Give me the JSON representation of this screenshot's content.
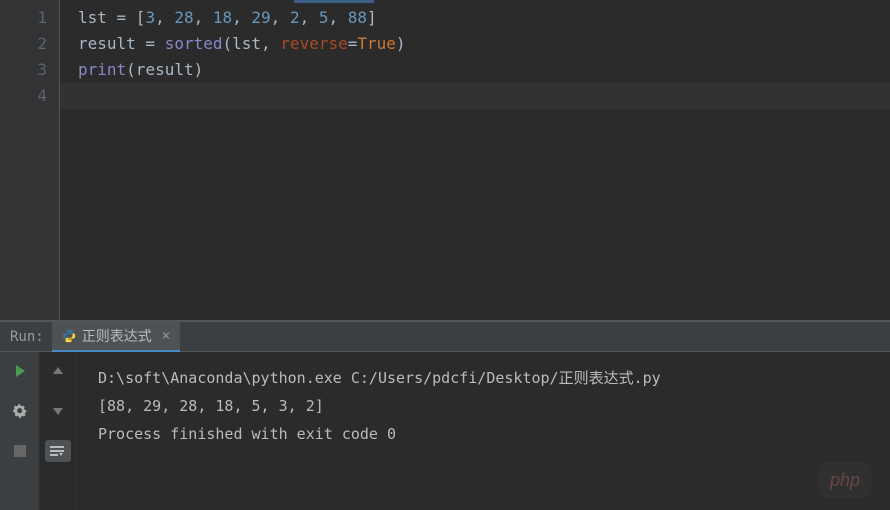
{
  "editor": {
    "line_numbers": [
      "1",
      "2",
      "3",
      "4"
    ],
    "lines": {
      "l1": {
        "t0": "lst = [",
        "n1": "3",
        "c1": ", ",
        "n2": "28",
        "c2": ", ",
        "n3": "18",
        "c3": ", ",
        "n4": "29",
        "c4": ", ",
        "n5": "2",
        "c5": ", ",
        "n6": "5",
        "c6": ", ",
        "n7": "88",
        "t1": "]"
      },
      "l2": {
        "t0": "result = ",
        "fn": "sorted",
        "p0": "(lst, ",
        "kw": "reverse",
        "eq": "=",
        "val": "True",
        "p1": ")"
      },
      "l3": {
        "fn": "print",
        "p0": "(result)"
      }
    }
  },
  "run": {
    "label": "Run:",
    "tab_title": "正则表达式",
    "output": {
      "cmd": "D:\\soft\\Anaconda\\python.exe C:/Users/pdcfi/Desktop/正则表达式.py",
      "line1": "[88, 29, 28, 18, 5, 3, 2]",
      "line2": "",
      "line3": "Process finished with exit code 0"
    }
  },
  "watermark": "php"
}
